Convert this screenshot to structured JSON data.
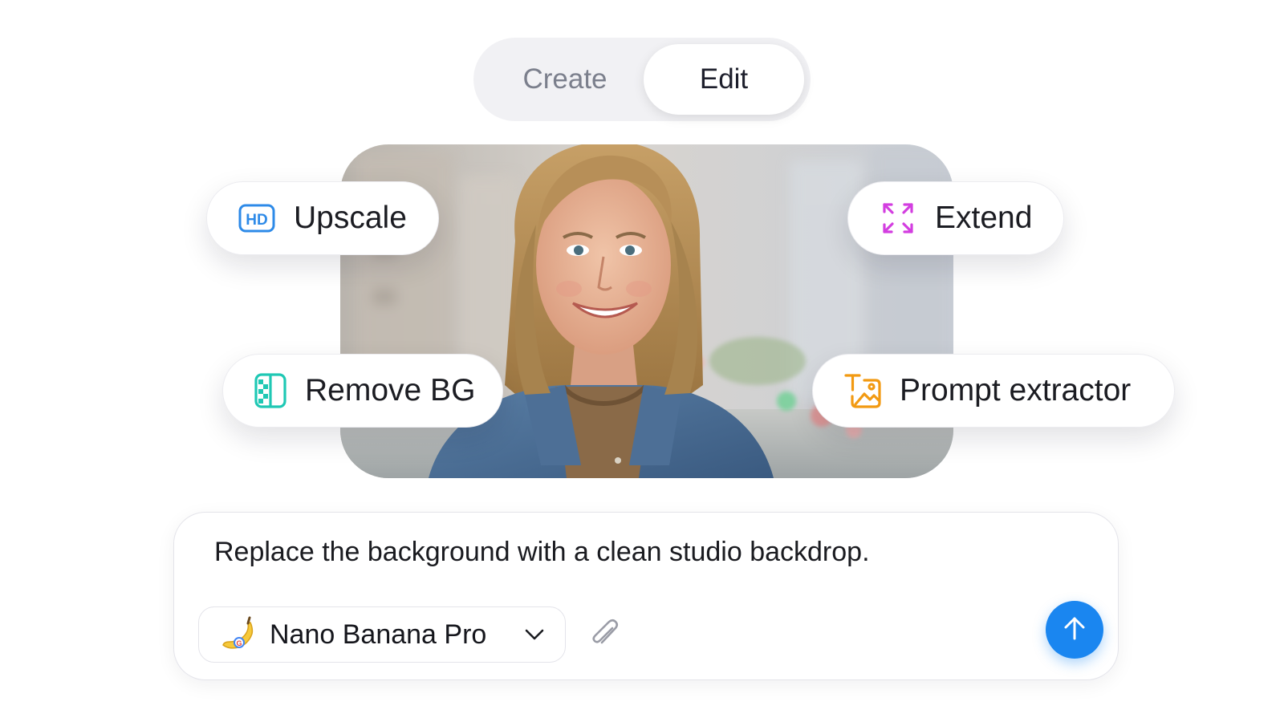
{
  "mode_toggle": {
    "tabs": [
      {
        "label": "Create",
        "selected": false
      },
      {
        "label": "Edit",
        "selected": true
      }
    ]
  },
  "tools": {
    "upscale": {
      "label": "Upscale",
      "icon": "hd-icon"
    },
    "extend": {
      "label": "Extend",
      "icon": "expand-arrows-icon"
    },
    "remove_bg": {
      "label": "Remove BG",
      "icon": "remove-background-icon"
    },
    "prompt_extractor": {
      "label": "Prompt extractor",
      "icon": "text-to-image-icon"
    }
  },
  "composer": {
    "prompt": "Replace the background with a clean studio backdrop.",
    "model": {
      "name": "Nano Banana Pro",
      "icon": "banana-icon"
    },
    "attach_icon": "paperclip-icon",
    "send_icon": "arrow-up-icon"
  },
  "colors": {
    "accent_blue": "#1a86f0",
    "hd_blue": "#2d8ae8",
    "extend_magenta": "#d33ee0",
    "removebg_teal": "#1fc8b4",
    "prompt_orange": "#f29a12"
  }
}
